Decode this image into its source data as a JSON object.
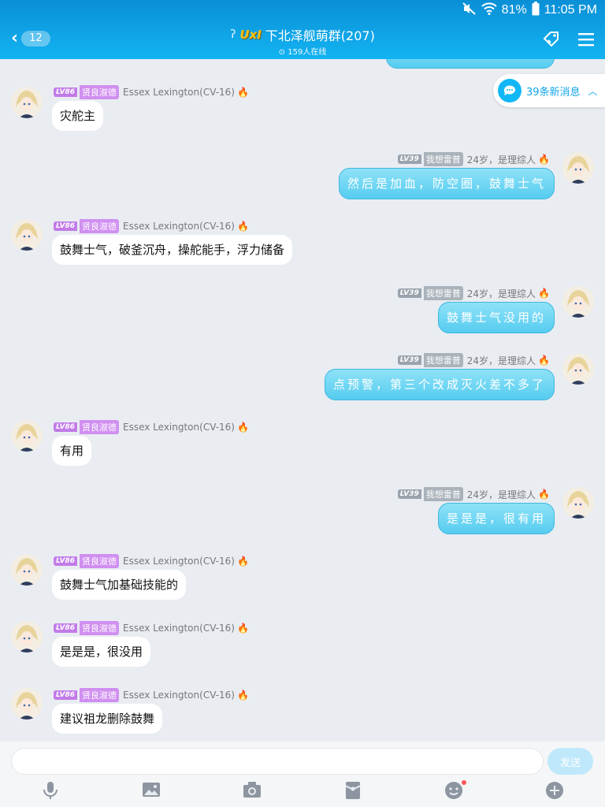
{
  "status": {
    "battery": "81%",
    "time": "11:05 PM"
  },
  "header": {
    "back_count": "12",
    "badge": "UxI",
    "title": "下北泽舰萌群(207)",
    "subtitle": "159人在线"
  },
  "new_messages": "39条新消息",
  "messages": [
    {
      "side": "left",
      "level": "LV86",
      "title": "贤良淑德",
      "name": "Essex Lexington(CV-16)",
      "text": "灾舵主"
    },
    {
      "side": "right",
      "level": "LV39",
      "title": "我想雷普",
      "name": "24岁，是理综人",
      "text": "然后是加血，防空圈，鼓舞士气"
    },
    {
      "side": "left",
      "level": "LV86",
      "title": "贤良淑德",
      "name": "Essex Lexington(CV-16)",
      "text": "鼓舞士气，破釜沉舟，操舵能手，浮力储备"
    },
    {
      "side": "right",
      "level": "LV39",
      "title": "我想雷普",
      "name": "24岁，是理综人",
      "text": "鼓舞士气没用的"
    },
    {
      "side": "right",
      "level": "LV39",
      "title": "我想雷普",
      "name": "24岁，是理综人",
      "text": "点预警，第三个改成灭火差不多了"
    },
    {
      "side": "left",
      "level": "LV86",
      "title": "贤良淑德",
      "name": "Essex Lexington(CV-16)",
      "text": "有用"
    },
    {
      "side": "right",
      "level": "LV39",
      "title": "我想雷普",
      "name": "24岁，是理综人",
      "text": "是是是，很有用"
    },
    {
      "side": "left",
      "level": "LV86",
      "title": "贤良淑德",
      "name": "Essex Lexington(CV-16)",
      "text": "鼓舞士气加基础技能的"
    },
    {
      "side": "left",
      "level": "LV86",
      "title": "贤良淑德",
      "name": "Essex Lexington(CV-16)",
      "text": "是是是，很没用"
    },
    {
      "side": "left",
      "level": "LV86",
      "title": "贤良淑德",
      "name": "Essex Lexington(CV-16)",
      "text": "建议祖龙删除鼓舞"
    }
  ],
  "input": {
    "placeholder": "",
    "send_label": "发送"
  },
  "toolbar_icons": [
    "microphone-icon",
    "image-icon",
    "camera-icon",
    "red-packet-icon",
    "emoji-icon",
    "plus-icon"
  ],
  "colors": {
    "header": "#13b3f2",
    "accent": "#12a6e8",
    "bubble_right": "#56ccf0",
    "background": "#e9edf2"
  }
}
